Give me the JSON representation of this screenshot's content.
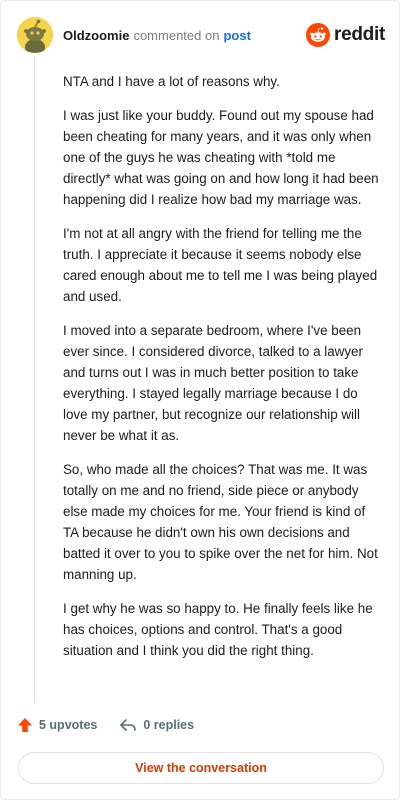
{
  "header": {
    "author": "Oldzoomie",
    "action_text": "commented on",
    "post_link": "post",
    "brand_word": "reddit"
  },
  "comment": {
    "paragraphs": [
      "NTA and I have a lot of reasons why.",
      "I was just like your buddy. Found out my spouse had been cheating for many years, and it was only when one of the guys he was cheating with *told me directly* what was going on and how long it had been happening did I realize how bad my marriage was.",
      "I'm not at all angry with the friend for telling me the truth. I appreciate it because it seems nobody else cared enough about me to tell me I was being played and used.",
      "I moved into a separate bedroom, where I've been ever since. I considered divorce, talked to a lawyer and turns out I was in much better position to take everything. I stayed legally marriage because I do love my partner, but recognize our relationship will never be what it as.",
      "So, who made all the choices? That was me. It was totally on me and no friend, side piece or anybody else made my choices for me. Your friend is kind of TA because he didn't own his own decisions and batted it over to you to spike over the net for him. Not manning up.",
      "I get why he was so happy to. He finally feels like he has choices, options and control. That's a good situation and I think you did the right thing."
    ]
  },
  "actions": {
    "upvotes": "5 upvotes",
    "replies": "0 replies"
  },
  "view_button": "View the conversation",
  "colors": {
    "brand_orange": "#ff4500",
    "button_text": "#d93a00",
    "link_blue": "#1a6fd6",
    "avatar_yellow": "#f5d34a"
  },
  "icons": {
    "avatar": "snoo-avatar-icon",
    "brand": "reddit-logo-icon",
    "upvote": "upvote-arrow-icon",
    "reply": "reply-arrow-icon"
  }
}
